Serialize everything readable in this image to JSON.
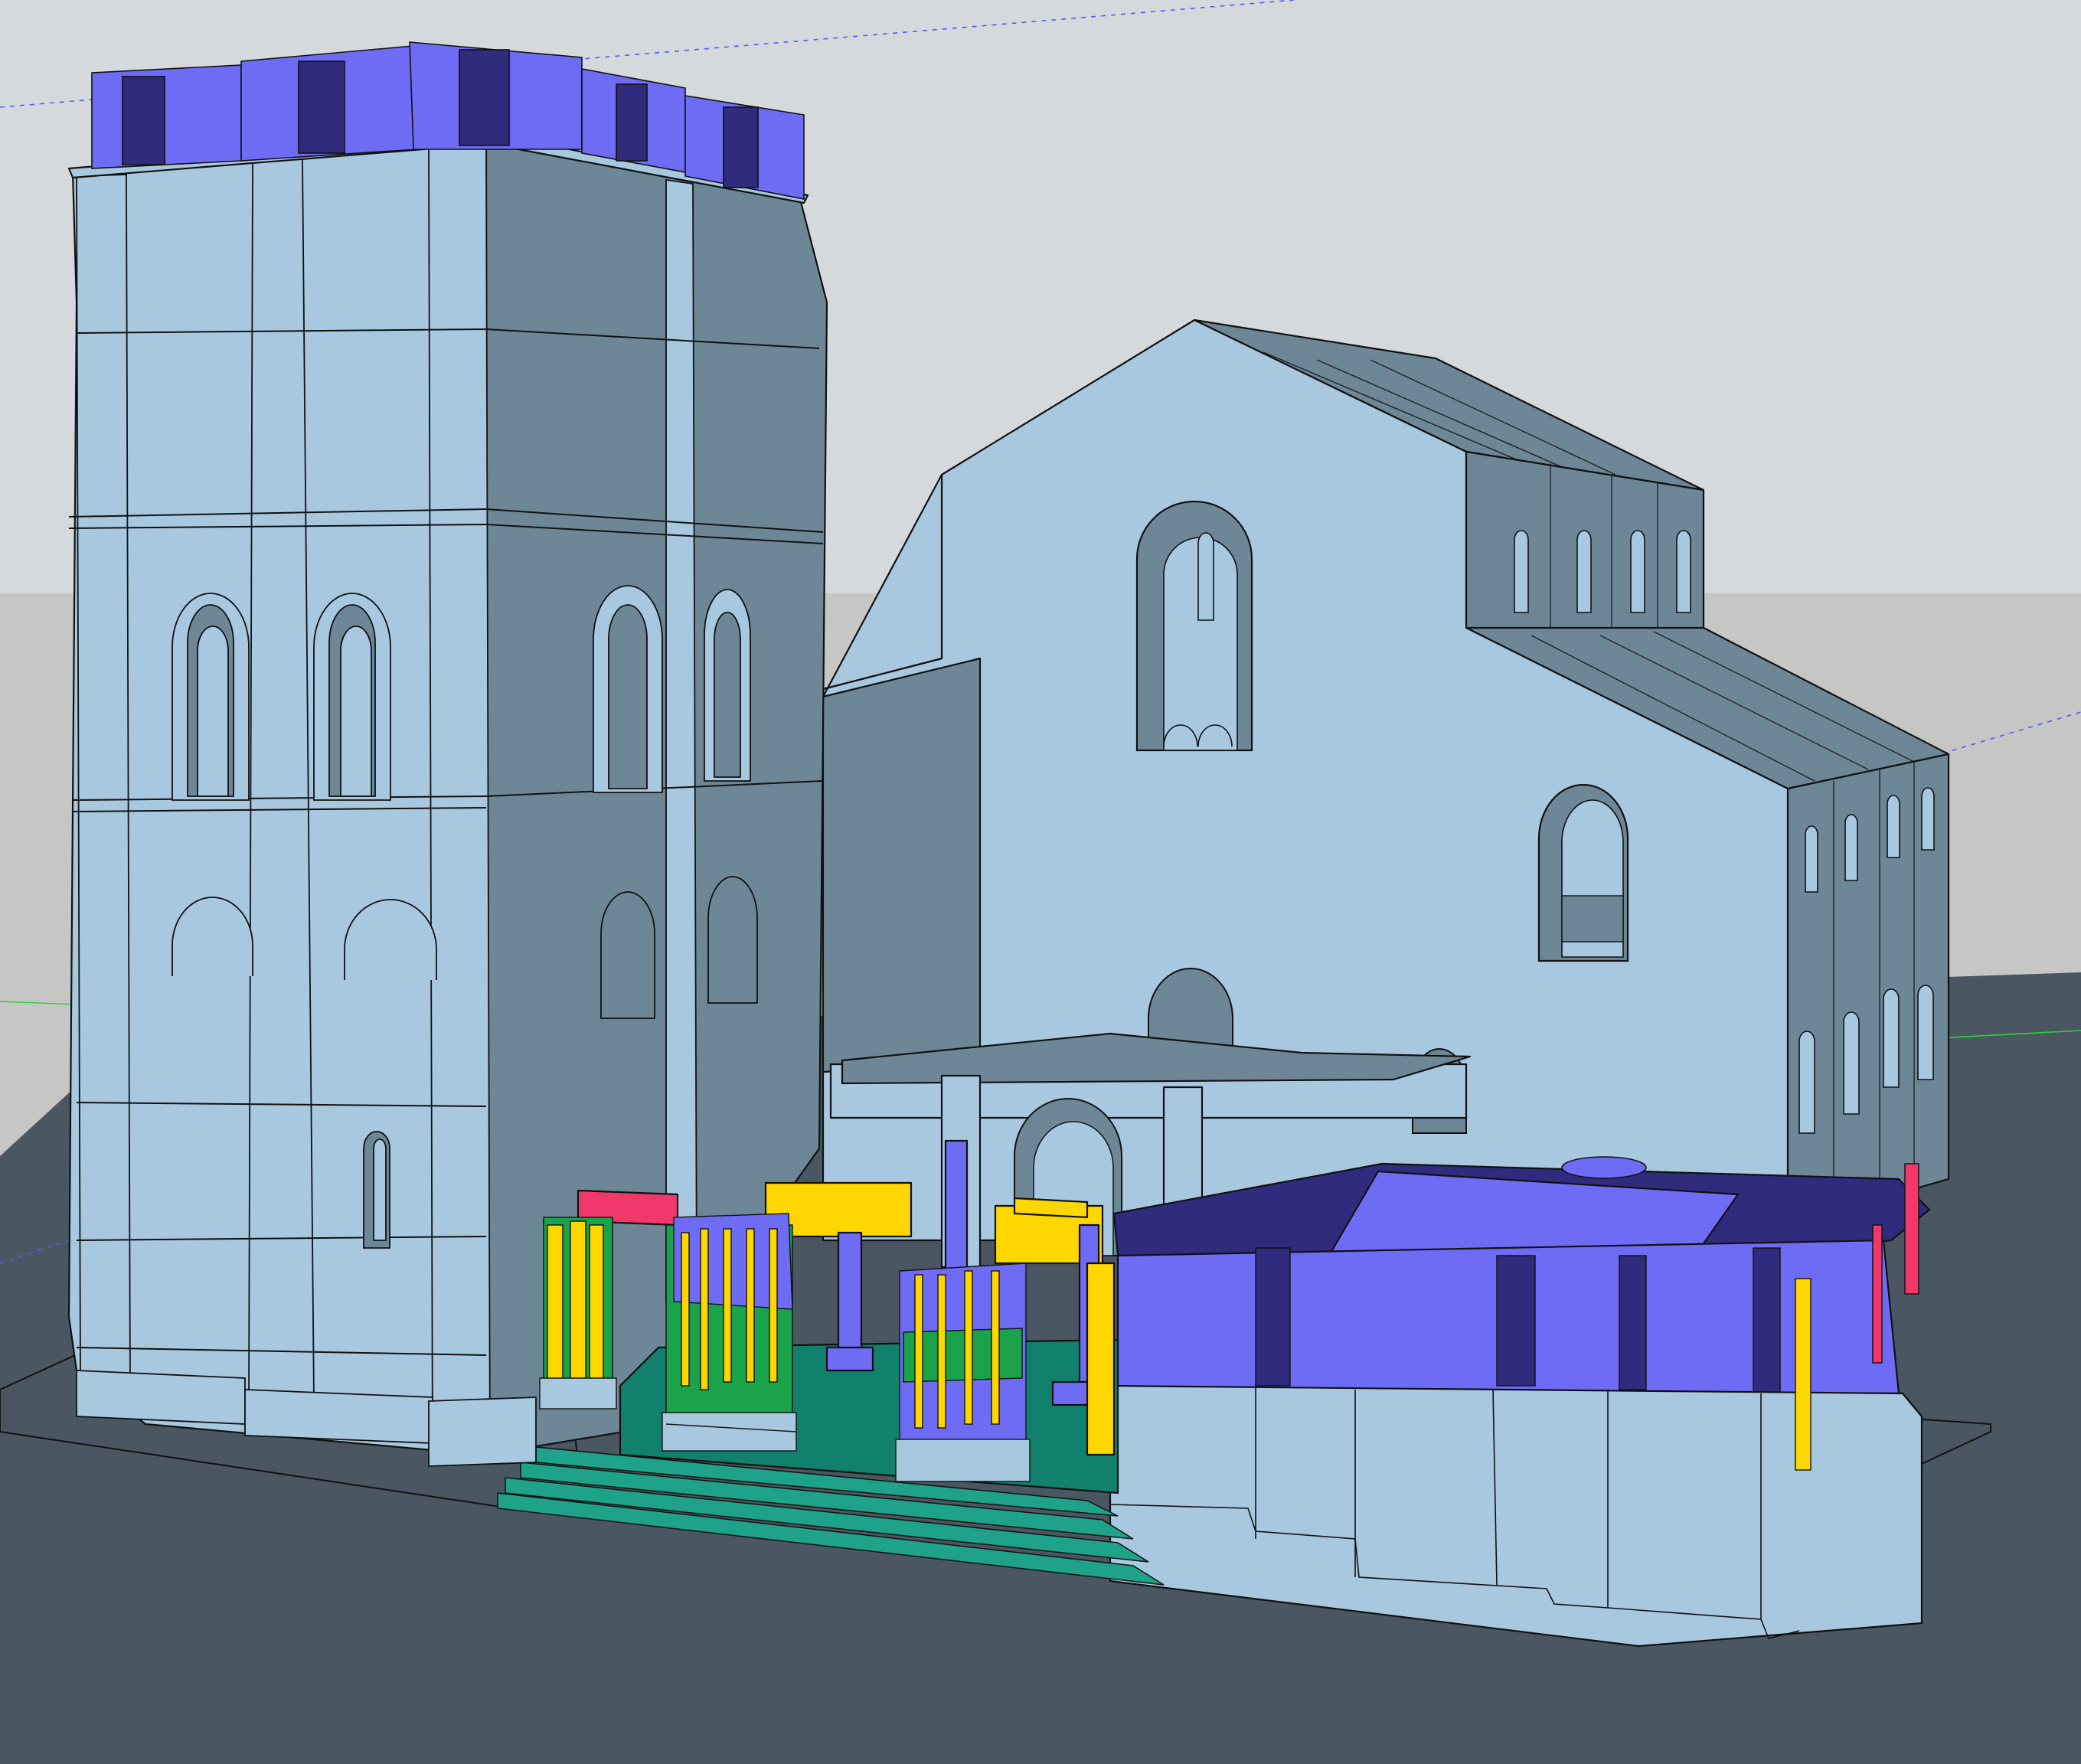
{
  "app": {
    "name": "",
    "model_description": ""
  },
  "scene": {
    "colors": {
      "sky": "#d6d9dc",
      "horizon_ground": "#c6c6c4",
      "ground_plane": "#4a5661",
      "front_face": "#a8c8df",
      "side_face": "#6e8797",
      "roof_side": "#6e8797",
      "accent_violet": "#6e6cf5",
      "accent_dark_violet": "#2f2c7e",
      "accent_yellow": "#ffd700",
      "accent_green": "#1aa34a",
      "accent_teal": "#11806c",
      "accent_pink": "#f0386a",
      "axis_blue": "#4b5cff",
      "axis_green": "#2bd23a"
    },
    "icons": [
      "red-axis-line-icon",
      "green-axis-line-icon",
      "blue-axis-line-icon"
    ]
  }
}
